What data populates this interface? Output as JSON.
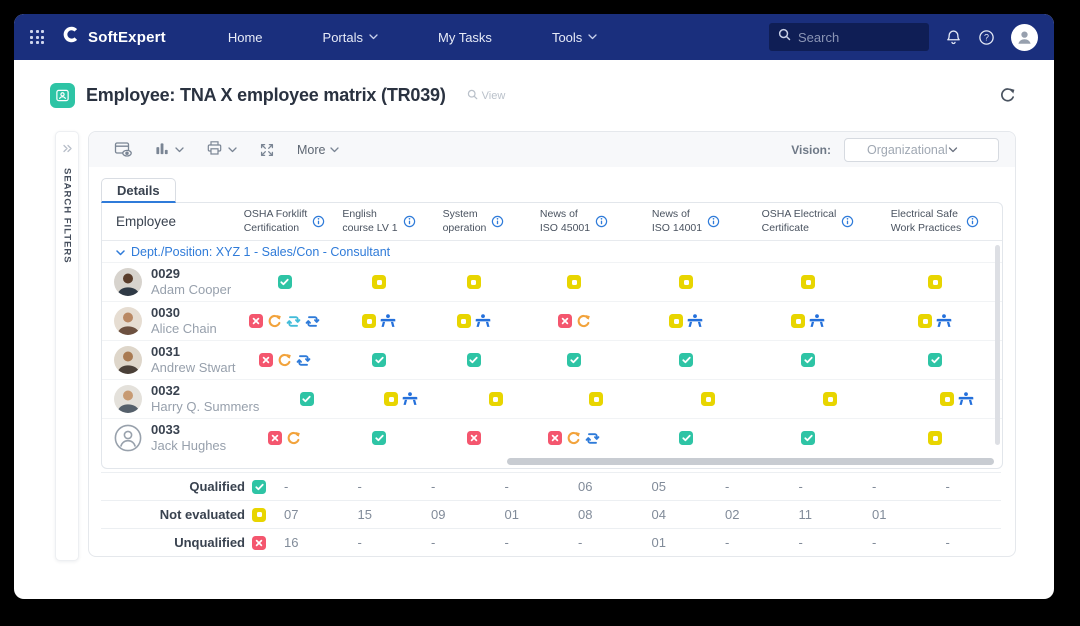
{
  "colors": {
    "navy": "#1A2F7D",
    "qualified": "#2EC4A5",
    "not_evaluated": "#E8D500",
    "unqualified": "#F4566E",
    "refresh": "#F2A33C",
    "loop_teal": "#43BCD9",
    "loop_blue": "#2F7BD9",
    "training": "#2470DB",
    "info": "#2F7BD9"
  },
  "navbar": {
    "brand": "SoftExpert",
    "items": [
      {
        "label": "Home",
        "dropdown": false
      },
      {
        "label": "Portals",
        "dropdown": true
      },
      {
        "label": "My Tasks",
        "dropdown": false
      },
      {
        "label": "Tools",
        "dropdown": true
      }
    ],
    "search": {
      "placeholder": "Search"
    }
  },
  "page": {
    "title": "Employee: TNA X employee matrix (TR039)",
    "view_label": "View"
  },
  "sidebar": {
    "label": "SEARCH FILTERS"
  },
  "toolbar": {
    "more_label": "More",
    "vision_label": "Vision:",
    "vision_value": "Organizational"
  },
  "tab": {
    "label": "Details"
  },
  "matrix": {
    "employee_header": "Employee",
    "columns": [
      "OSHA Forklift\nCertification",
      "English\ncourse LV 1",
      "System\noperation",
      "News of\nISO 45001",
      "News of\nISO 14001",
      "OSHA Electrical\nCertificate",
      "Electrical Safe\nWork Practices"
    ],
    "group_label": "Dept./Position: XYZ 1 - Sales/Con - Consultant",
    "rows": [
      {
        "id": "0029",
        "name": "Adam Cooper",
        "avatar": "photo",
        "cells": [
          [
            "qualified"
          ],
          [
            "not-evaluated"
          ],
          [
            "not-evaluated"
          ],
          [
            "not-evaluated"
          ],
          [
            "not-evaluated"
          ],
          [
            "not-evaluated"
          ],
          [
            "not-evaluated"
          ]
        ]
      },
      {
        "id": "0030",
        "name": "Alice Chain",
        "avatar": "photo",
        "cells": [
          [
            "unqualified",
            "refresh",
            "loop-teal",
            "loop-blue"
          ],
          [
            "not-evaluated",
            "training"
          ],
          [
            "not-evaluated",
            "training"
          ],
          [
            "unqualified",
            "refresh"
          ],
          [
            "not-evaluated",
            "training"
          ],
          [
            "not-evaluated",
            "training"
          ],
          [
            "not-evaluated",
            "training"
          ]
        ]
      },
      {
        "id": "0031",
        "name": "Andrew Stwart",
        "avatar": "photo",
        "cells": [
          [
            "unqualified",
            "refresh",
            "loop-blue"
          ],
          [
            "qualified"
          ],
          [
            "qualified"
          ],
          [
            "qualified"
          ],
          [
            "qualified"
          ],
          [
            "qualified"
          ],
          [
            "qualified"
          ]
        ]
      },
      {
        "id": "0032",
        "name": "Harry Q. Summers",
        "avatar": "photo",
        "cells": [
          [
            "qualified"
          ],
          [
            "not-evaluated",
            "training"
          ],
          [
            "not-evaluated"
          ],
          [
            "not-evaluated"
          ],
          [
            "not-evaluated"
          ],
          [
            "not-evaluated"
          ],
          [
            "not-evaluated",
            "training"
          ]
        ]
      },
      {
        "id": "0033",
        "name": "Jack Hughes",
        "avatar": "placeholder",
        "cells": [
          [
            "unqualified",
            "refresh"
          ],
          [
            "qualified"
          ],
          [
            "unqualified"
          ],
          [
            "unqualified",
            "refresh",
            "loop-blue"
          ],
          [
            "qualified"
          ],
          [
            "qualified"
          ],
          [
            "not-evaluated"
          ]
        ]
      }
    ]
  },
  "summary": {
    "rows": [
      {
        "label": "Qualified",
        "icon": "qualified",
        "values": [
          "-",
          "-",
          "-",
          "-",
          "06",
          "05",
          "-",
          "-",
          "-",
          "-"
        ]
      },
      {
        "label": "Not evaluated",
        "icon": "not-evaluated",
        "values": [
          "07",
          "15",
          "09",
          "01",
          "08",
          "04",
          "02",
          "11",
          "01",
          ""
        ]
      },
      {
        "label": "Unqualified",
        "icon": "unqualified",
        "values": [
          "16",
          "-",
          "-",
          "-",
          "-",
          "01",
          "-",
          "-",
          "-",
          "-"
        ]
      }
    ]
  }
}
